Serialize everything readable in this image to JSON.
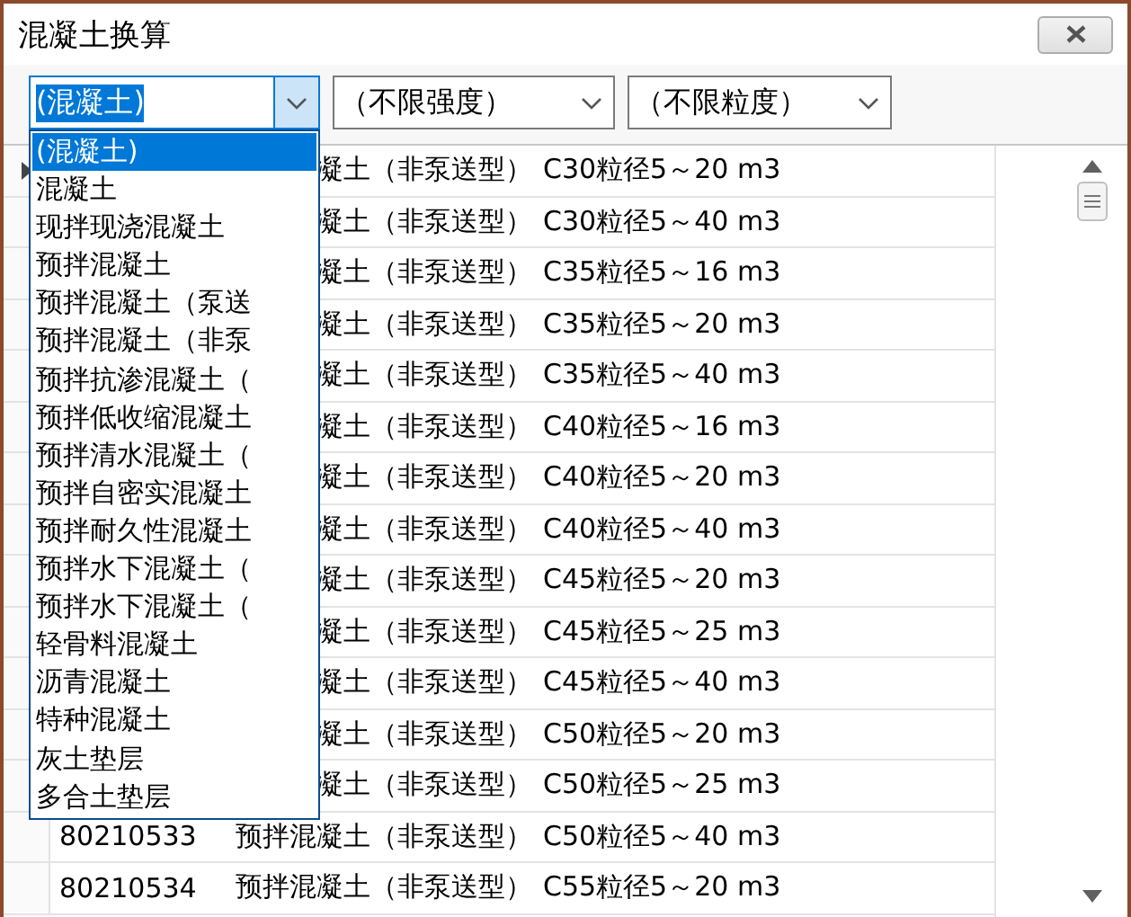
{
  "window": {
    "title": "混凝土换算"
  },
  "filters": [
    {
      "value": "(混凝土)",
      "expanded": true,
      "options": [
        {
          "label": "(混凝土)",
          "selected": true
        },
        {
          "label": "混凝土",
          "selected": false
        },
        {
          "label": "现拌现浇混凝土",
          "selected": false
        },
        {
          "label": "预拌混凝土",
          "selected": false
        },
        {
          "label": "预拌混凝土（泵送",
          "selected": false
        },
        {
          "label": "预拌混凝土（非泵",
          "selected": false
        },
        {
          "label": "预拌抗渗混凝土（",
          "selected": false
        },
        {
          "label": "预拌低收缩混凝土",
          "selected": false
        },
        {
          "label": "预拌清水混凝土（",
          "selected": false
        },
        {
          "label": "预拌自密实混凝土",
          "selected": false
        },
        {
          "label": "预拌耐久性混凝土",
          "selected": false
        },
        {
          "label": "预拌水下混凝土（",
          "selected": false
        },
        {
          "label": "预拌水下混凝土（",
          "selected": false
        },
        {
          "label": "轻骨料混凝土",
          "selected": false
        },
        {
          "label": "沥青混凝土",
          "selected": false
        },
        {
          "label": "特种混凝土",
          "selected": false
        },
        {
          "label": "灰土垫层",
          "selected": false
        },
        {
          "label": "多合土垫层",
          "selected": false
        }
      ]
    },
    {
      "value": "（不限强度）",
      "expanded": false
    },
    {
      "value": "（不限粒度）",
      "expanded": false
    }
  ],
  "rows": [
    {
      "name": "凝土（非泵送型）",
      "spec": "C30粒径5～20 m3",
      "current": true
    },
    {
      "name": "凝土（非泵送型）",
      "spec": "C30粒径5～40 m3",
      "current": false
    },
    {
      "name": "凝土（非泵送型）",
      "spec": "C35粒径5～16 m3",
      "current": false
    },
    {
      "name": "凝土（非泵送型）",
      "spec": "C35粒径5～20 m3",
      "current": false
    },
    {
      "name": "凝土（非泵送型）",
      "spec": "C35粒径5～40 m3",
      "current": false
    },
    {
      "name": "凝土（非泵送型）",
      "spec": "C40粒径5～16 m3",
      "current": false
    },
    {
      "name": "凝土（非泵送型）",
      "spec": "C40粒径5～20 m3",
      "current": false
    },
    {
      "name": "凝土（非泵送型）",
      "spec": "C40粒径5～40 m3",
      "current": false
    },
    {
      "name": "凝土（非泵送型）",
      "spec": "C45粒径5～20 m3",
      "current": false
    },
    {
      "name": "凝土（非泵送型）",
      "spec": "C45粒径5～25 m3",
      "current": false
    },
    {
      "name": "凝土（非泵送型）",
      "spec": "C45粒径5～40 m3",
      "current": false
    },
    {
      "name": "凝土（非泵送型）",
      "spec": "C50粒径5～20 m3",
      "current": false
    },
    {
      "name": "凝土（非泵送型）",
      "spec": "C50粒径5～25 m3",
      "current": false
    },
    {
      "code": "80210533",
      "name": "预拌混凝土（非泵送型）",
      "spec": "C50粒径5～40 m3",
      "current": false
    },
    {
      "code": "80210534",
      "name": "预拌混凝土（非泵送型）",
      "spec": "C55粒径5～20 m3",
      "current": false
    }
  ]
}
